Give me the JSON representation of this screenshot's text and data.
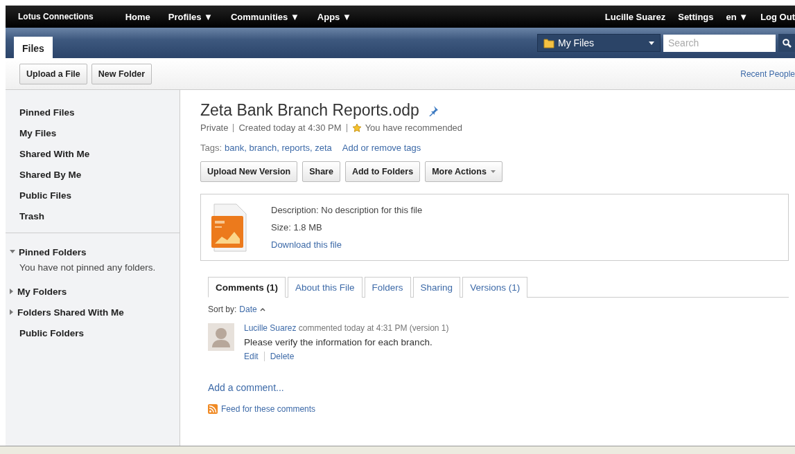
{
  "top_nav": {
    "brand": "Lotus Connections",
    "items": [
      "Home",
      "Profiles ▼",
      "Communities ▼",
      "Apps ▼"
    ],
    "user_items": [
      "Lucille Suarez",
      "Settings",
      "en ▼",
      "Log Out"
    ]
  },
  "banner": {
    "tabs": [
      {
        "label": "Files",
        "selected": true
      }
    ],
    "scope_dropdown": {
      "label": "My Files"
    },
    "search": {
      "placeholder": "Search"
    }
  },
  "toolbar": {
    "buttons": [
      "Upload a File",
      "New Folder"
    ],
    "link": "Recent People"
  },
  "sidebar": {
    "items": [
      "Pinned Files",
      "My Files",
      "Shared With Me",
      "Shared By Me",
      "Public Files",
      "Trash"
    ],
    "sections": [
      {
        "kind": "twisty",
        "label": "Pinned Folders",
        "expanded": true,
        "empty_text": "You have not pinned any folders."
      },
      {
        "kind": "twisty",
        "label": "My Folders",
        "expanded": false
      },
      {
        "kind": "twisty",
        "label": "Folders Shared With Me",
        "expanded": false
      },
      {
        "kind": "plain",
        "label": "Public Folders"
      }
    ]
  },
  "file": {
    "title": "Zeta Bank Branch Reports.odp",
    "pinned": true,
    "visibility": "Private",
    "created": "Created today at 4:30 PM",
    "recommended": true,
    "recommendation": "You have recommended",
    "tags_label": "Tags:",
    "tag_separator": ",",
    "tags": [
      "bank",
      "branch",
      "reports",
      "zeta"
    ],
    "tags_action": "Add or remove tags",
    "actions": [
      {
        "label": "Upload New Version",
        "dropdown": false
      },
      {
        "label": "Share",
        "dropdown": false
      },
      {
        "label": "Add to Folders",
        "dropdown": false
      },
      {
        "label": "More Actions",
        "dropdown": true
      }
    ],
    "description": "Description: No description for this file",
    "size": "Size: 1.8 MB",
    "download": "Download this file"
  },
  "tabs": [
    {
      "label": "Comments (1)",
      "selected": true
    },
    {
      "label": "About this File",
      "selected": false
    },
    {
      "label": "Folders",
      "selected": false
    },
    {
      "label": "Sharing",
      "selected": false
    },
    {
      "label": "Versions (1)",
      "selected": false
    }
  ],
  "sort": {
    "label": "Sort by:",
    "field": "Date",
    "ascending": true
  },
  "comments": [
    {
      "author": "Lucille Suarez",
      "meta": "commented today at 4:31 PM (version 1)",
      "text": "Please verify the information for each branch.",
      "actions": [
        "Edit",
        "Delete"
      ]
    }
  ],
  "add_comment": "Add a comment...",
  "feed": "Feed for these comments"
}
